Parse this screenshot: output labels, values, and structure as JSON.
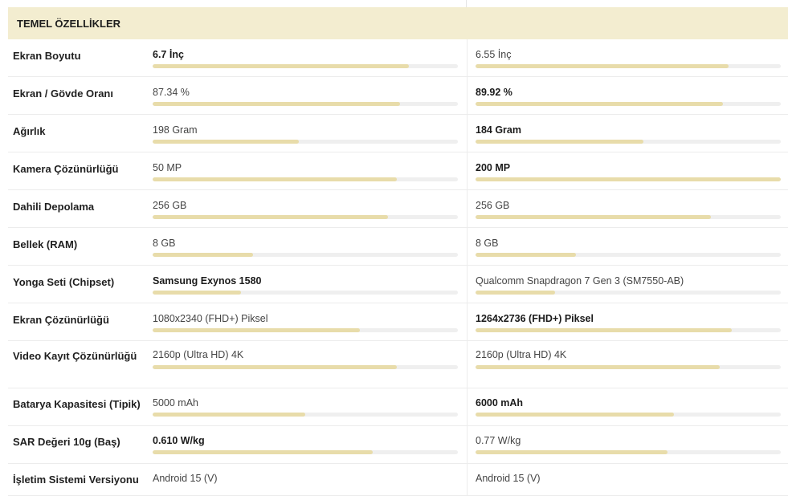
{
  "section": {
    "title": "TEMEL ÖZELLİKLER"
  },
  "rows": [
    {
      "label": "Ekran Boyutu",
      "p1": {
        "value": "6.7 İnç",
        "best": true,
        "fill": 0.84
      },
      "p2": {
        "value": "6.55 İnç",
        "best": false,
        "fill": 0.83
      }
    },
    {
      "label": "Ekran / Gövde Oranı",
      "p1": {
        "value": "87.34 %",
        "best": false,
        "fill": 0.81
      },
      "p2": {
        "value": "89.92 %",
        "best": true,
        "fill": 0.81
      }
    },
    {
      "label": "Ağırlık",
      "p1": {
        "value": "198 Gram",
        "best": false,
        "fill": 0.48
      },
      "p2": {
        "value": "184 Gram",
        "best": true,
        "fill": 0.55
      }
    },
    {
      "label": "Kamera Çözünürlüğü",
      "p1": {
        "value": "50 MP",
        "best": false,
        "fill": 0.8
      },
      "p2": {
        "value": "200 MP",
        "best": true,
        "fill": 1.0
      }
    },
    {
      "label": "Dahili Depolama",
      "p1": {
        "value": "256 GB",
        "best": false,
        "fill": 0.77
      },
      "p2": {
        "value": "256 GB",
        "best": false,
        "fill": 0.77
      }
    },
    {
      "label": "Bellek (RAM)",
      "p1": {
        "value": "8 GB",
        "best": false,
        "fill": 0.33
      },
      "p2": {
        "value": "8 GB",
        "best": false,
        "fill": 0.33
      }
    },
    {
      "label": "Yonga Seti (Chipset)",
      "p1": {
        "value": "Samsung Exynos 1580",
        "best": true,
        "fill": 0.29
      },
      "p2": {
        "value": "Qualcomm Snapdragon 7 Gen 3 (SM7550-AB)",
        "best": false,
        "fill": 0.26
      }
    },
    {
      "label": "Ekran Çözünürlüğü",
      "p1": {
        "value": "1080x2340 (FHD+) Piksel",
        "best": false,
        "fill": 0.68
      },
      "p2": {
        "value": "1264x2736 (FHD+) Piksel",
        "best": true,
        "fill": 0.84
      }
    },
    {
      "label": "Video Kayıt Çözünürlüğü",
      "p1": {
        "value": "2160p (Ultra HD) 4K",
        "best": false,
        "fill": 0.8
      },
      "p2": {
        "value": "2160p (Ultra HD) 4K",
        "best": false,
        "fill": 0.8
      }
    },
    {
      "label": "Batarya Kapasitesi (Tipik)",
      "p1": {
        "value": "5000 mAh",
        "best": false,
        "fill": 0.5
      },
      "p2": {
        "value": "6000 mAh",
        "best": true,
        "fill": 0.65
      }
    },
    {
      "label": "SAR Değeri 10g (Baş)",
      "p1": {
        "value": "0.610 W/kg",
        "best": true,
        "fill": 0.72
      },
      "p2": {
        "value": "0.77 W/kg",
        "best": false,
        "fill": 0.63
      }
    },
    {
      "label": "İşletim Sistemi Versiyonu",
      "p1": {
        "value": "Android 15 (V)",
        "best": false,
        "fill": 0.0
      },
      "p2": {
        "value": "Android 15 (V)",
        "best": false,
        "fill": 0.0
      }
    }
  ]
}
